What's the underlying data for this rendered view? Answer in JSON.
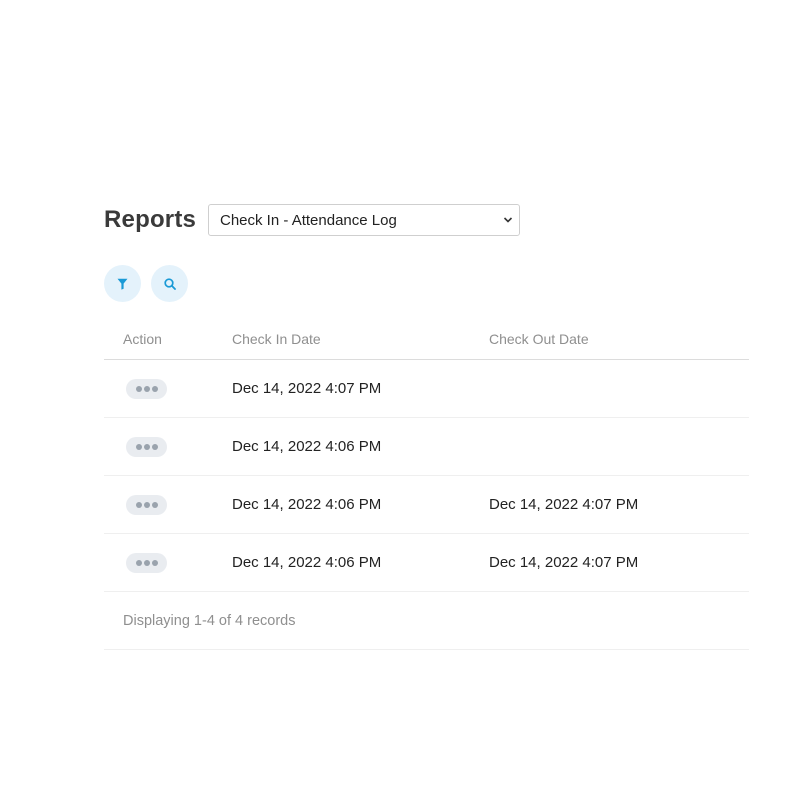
{
  "page": {
    "title": "Reports"
  },
  "report_select": {
    "value": "Check In - Attendance Log",
    "icon": "chevron-down-icon"
  },
  "toolbar": {
    "filter_icon": "filter-icon",
    "search_icon": "search-icon",
    "accent_color": "#1a9ad6",
    "button_bg": "#e4f2fb"
  },
  "table": {
    "columns": [
      "Action",
      "Check In Date",
      "Check Out Date"
    ],
    "rows": [
      {
        "check_in": "Dec 14, 2022 4:07 PM",
        "check_out": ""
      },
      {
        "check_in": "Dec 14, 2022 4:06 PM",
        "check_out": ""
      },
      {
        "check_in": "Dec 14, 2022 4:06 PM",
        "check_out": "Dec 14, 2022 4:07 PM"
      },
      {
        "check_in": "Dec 14, 2022 4:06 PM",
        "check_out": "Dec 14, 2022 4:07 PM"
      }
    ],
    "row_action_icon": "more-horizontal-icon",
    "footer": "Displaying 1-4 of 4 records"
  }
}
